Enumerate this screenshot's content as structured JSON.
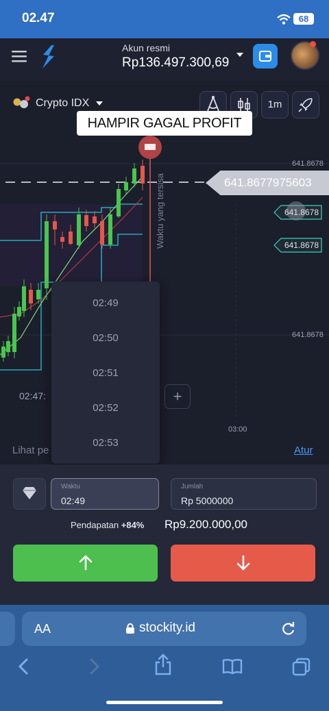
{
  "status_bar": {
    "time": "02.47",
    "battery": "68"
  },
  "header": {
    "account_label": "Akun resmi",
    "balance": "Rp136.497.300,69"
  },
  "chart": {
    "asset": "Crypto IDX",
    "timeframe": "1m",
    "banner": "HAMPIR GAGAL PROFIT",
    "current_price": "641.8677975603",
    "order_tags": [
      "641.8678",
      "641.8678"
    ],
    "price_labels": [
      "641.8678",
      "641.8678"
    ],
    "vertical_label": "Waktu yang tersisa",
    "time_axis": [
      "02:47:",
      "03:00"
    ],
    "footer_label": "Lihat pe",
    "settings_link": "Atur",
    "time_options": [
      "02:49",
      "02:50",
      "02:51",
      "02:52",
      "02:53"
    ]
  },
  "trade": {
    "time_label": "Waktu",
    "time_value": "02:49",
    "amount_label": "Jumlah",
    "amount_value": "Rp 5000000",
    "income_label": "Pendapatan",
    "income_pct": "+84%",
    "income_value": "Rp9.200.000,00"
  },
  "browser": {
    "aa": "AA",
    "url": "stockity.id"
  },
  "colors": {
    "up": "#4cbf4f",
    "down": "#e65a4a",
    "brand": "#2b8de8",
    "browser": "#2f5d97"
  }
}
